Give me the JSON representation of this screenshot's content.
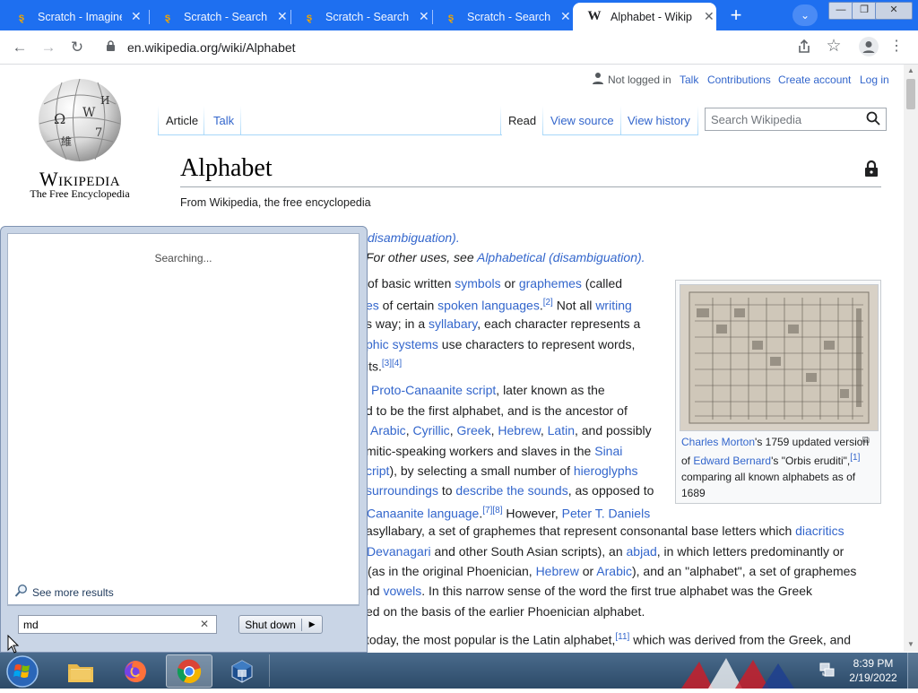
{
  "browser": {
    "tabs": [
      {
        "title": "Scratch - Imagine",
        "active": false
      },
      {
        "title": "Scratch - Search",
        "active": false
      },
      {
        "title": "Scratch - Search",
        "active": false
      },
      {
        "title": "Scratch - Search",
        "active": false
      },
      {
        "title": "Alphabet - Wikip",
        "active": true
      }
    ],
    "url": "en.wikipedia.org/wiki/Alphabet"
  },
  "wiki": {
    "wordmark": "Wikipedia",
    "tagline": "The Free Encyclopedia",
    "personal": {
      "not_logged_in": "Not logged in",
      "talk": "Talk",
      "contributions": "Contributions",
      "create_account": "Create account",
      "log_in": "Log in"
    },
    "tabs": {
      "article": "Article",
      "talk": "Talk",
      "read": "Read",
      "view_source": "View source",
      "view_history": "View history"
    },
    "search_placeholder": "Search Wikipedia",
    "title": "Alphabet",
    "from": "From Wikipedia, the free encyclopedia",
    "hatnote1": "disambiguation).",
    "hatnote2_pre": "For other uses, see ",
    "hatnote2_link": "Alphabetical (disambiguation).",
    "lines": {
      "l1a": "of basic written ",
      "l1b": "symbols",
      "l1c": " or ",
      "l1d": "graphemes",
      "l1e": " (called",
      "l2a": "es",
      "l2b": " of certain ",
      "l2c": "spoken languages",
      "l2d": ".",
      "l2sup": "[2]",
      "l2e": " Not all ",
      "l2f": "writing",
      "l3a": "s way; in a ",
      "l3b": "syllabary",
      "l3c": ", each character represents a",
      "l4a": "phic systems",
      "l4b": " use characters to represent words,",
      "l5a": "its.",
      "l5sup": "[3][4]",
      "l6a": "Proto-Canaanite script",
      "l6b": ", later known as the",
      "l7a": "d to be the first alphabet, and is the ancestor of",
      "l8a": "Arabic",
      "l8b": ", ",
      "l8c": "Cyrillic",
      "l8d": ", ",
      "l8e": "Greek",
      "l8f": ", ",
      "l8g": "Hebrew",
      "l8h": ", ",
      "l8i": "Latin",
      "l8j": ", and possibly",
      "l9a": "mitic-speaking workers and slaves in the ",
      "l9b": "Sinai",
      "l10a": "cript",
      "l10b": "), by selecting a small number of ",
      "l10c": "hieroglyphs",
      "l11a": "surroundings",
      "l11b": " to ",
      "l11c": "describe the sounds",
      "l11d": ", as opposed to",
      "l12a": "Canaanite language",
      "l12b": ".",
      "l12sup": "[7][8]",
      "l12c": " However, ",
      "l12d": "Peter T. Daniels",
      "l13a": "asyllabary, a set of graphemes that represent consonantal base letters which ",
      "l13b": "diacritics",
      "l14a": "Devanagari",
      "l14b": " and other South Asian scripts), an ",
      "l14c": "abjad",
      "l14d": ", in which letters predominantly or",
      "l15a": "(as in the original Phoenician, ",
      "l15b": "Hebrew",
      "l15c": " or ",
      "l15d": "Arabic",
      "l15e": "), and an \"alphabet\", a set of graphemes",
      "l16a": "nd ",
      "l16b": "vowels",
      "l16c": ". In this narrow sense of the word the first true alphabet was the Greek",
      "l17a": "ed on the basis of the earlier Phoenician alphabet.",
      "l18a": " today, the most popular is the Latin alphabet,",
      "l18sup": "[11]",
      "l18b": " which was derived from the Greek, and"
    },
    "caption": {
      "a": "Charles Morton",
      "b": "'s 1759 updated version of ",
      "c": "Edward Bernard",
      "d": "'s \"Orbis eruditi\",",
      "sup": "[1]",
      "e": " comparing all known alphabets as of 1689"
    }
  },
  "startmenu": {
    "status": "Searching...",
    "see_more": "See more results",
    "search_value": "md",
    "shutdown_label": "Shut down"
  },
  "taskbar": {
    "time": "8:39 PM",
    "date": "2/19/2022"
  }
}
